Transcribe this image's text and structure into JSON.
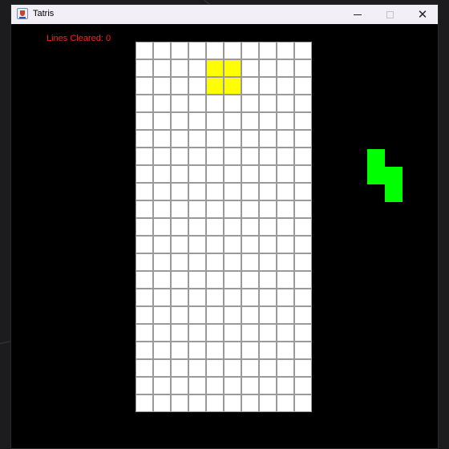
{
  "window": {
    "title": "Tatris",
    "controls": {
      "minimize_icon": "minimize-icon",
      "maximize_icon": "maximize-icon",
      "close_icon": "close-icon",
      "close_glyph": "✕"
    }
  },
  "status": {
    "lines_cleared_text": "Lines Cleared: 0",
    "lines_cleared": 0,
    "text_color": "#ff2020"
  },
  "board": {
    "columns": 10,
    "rows": 21,
    "empty_color": "#ffffff",
    "grid_color": "#9a9a9a",
    "active_piece": {
      "type": "O",
      "color": "#ffff00",
      "cells": [
        [
          4,
          1
        ],
        [
          5,
          1
        ],
        [
          4,
          2
        ],
        [
          5,
          2
        ]
      ]
    }
  },
  "next_piece": {
    "type": "S",
    "color": "#00ff00",
    "cells": [
      [
        0,
        0
      ],
      [
        0,
        1
      ],
      [
        1,
        1
      ],
      [
        1,
        2
      ]
    ]
  }
}
